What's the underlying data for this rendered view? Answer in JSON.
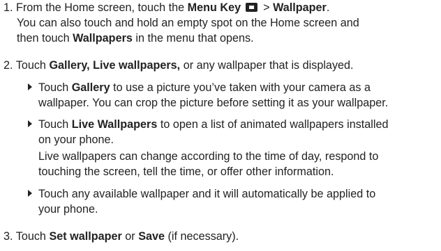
{
  "step1": {
    "number": "1.",
    "intro": "From the Home screen, touch the",
    "menu_key": "Menu Key",
    "icon": "menu-key-icon",
    "sep": ">",
    "wallpaper": "Wallpaper",
    "period": ".",
    "alt_line1": "You can also touch and hold an empty spot on the Home screen and",
    "alt_line2_pre": "then touch",
    "wallpapers": "Wallpapers",
    "alt_line2_post": "in the menu that opens."
  },
  "step2": {
    "number": "2.",
    "pre": "Touch",
    "options": "Gallery, Live wallpapers,",
    "post": "or any wallpaper that is displayed.",
    "bullets": [
      {
        "pre": "Touch",
        "bold": "Gallery",
        "line1_post": "to use a picture you’ve taken with your camera as a",
        "line2": "wallpaper. You can crop the picture before setting it as your wallpaper."
      },
      {
        "pre": "Touch",
        "bold": "Live Wallpapers",
        "line1_post": "to open a list of animated wallpapers installed",
        "line2": "on your phone.",
        "line3": "Live wallpapers can change according to the time of day, respond to",
        "line4": "touching the screen, tell the time, or offer other information."
      },
      {
        "line1": "Touch any available wallpaper and it will automatically be applied to",
        "line2": "your phone."
      }
    ]
  },
  "step3": {
    "number": "3.",
    "pre": "Touch",
    "set": "Set wallpaper",
    "or": "or",
    "save": "Save",
    "post": "(if necessary)."
  }
}
